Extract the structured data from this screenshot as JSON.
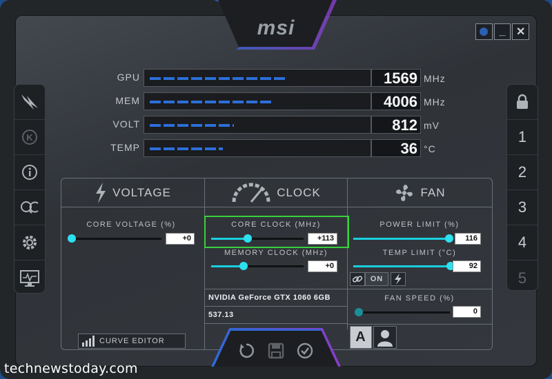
{
  "app": {
    "logo": "msi"
  },
  "window_controls": {
    "minimize": "_",
    "close": "✕"
  },
  "monitors": [
    {
      "label": "GPU",
      "value": "1569",
      "unit": "MHz",
      "level": 0.62
    },
    {
      "label": "MEM",
      "value": "4006",
      "unit": "MHz",
      "level": 0.55
    },
    {
      "label": "VOLT",
      "value": "812",
      "unit": "mV",
      "level": 0.38
    },
    {
      "label": "TEMP",
      "value": "36",
      "unit": "°C",
      "level": 0.33
    }
  ],
  "left_sidebar": {
    "items": [
      {
        "icon": "msi-dragon-icon"
      },
      {
        "icon": "kombustor-k-icon"
      },
      {
        "icon": "info-icon"
      },
      {
        "icon": "oc-scanner-icon"
      },
      {
        "icon": "settings-gear-icon"
      },
      {
        "icon": "monitor-icon"
      }
    ]
  },
  "right_sidebar": {
    "lock_icon": "lock-icon",
    "profiles": [
      "1",
      "2",
      "3",
      "4",
      "5"
    ]
  },
  "voltage": {
    "header": "VOLTAGE",
    "core_voltage_label": "CORE VOLTAGE  (%)",
    "core_voltage_value": "+0",
    "core_voltage_level": 0.0,
    "curve_editor_label": "CURVE EDITOR"
  },
  "clock": {
    "header": "CLOCK",
    "core_clock_label": "CORE CLOCK (MHz)",
    "core_clock_value": "+113",
    "core_clock_level": 0.4,
    "memory_clock_label": "MEMORY CLOCK (MHz)",
    "memory_clock_value": "+0",
    "memory_clock_level": 0.36,
    "gpu_name": "NVIDIA GeForce GTX 1060 6GB",
    "driver_version": "537.13"
  },
  "fan": {
    "header": "FAN",
    "power_limit_label": "POWER LIMIT  (%)",
    "power_limit_value": "116",
    "temp_limit_label": "TEMP LIMIT (°C)",
    "temp_limit_value": "92",
    "link_toggle": "ON",
    "fan_speed_label": "FAN SPEED  (%)",
    "fan_speed_value": "0"
  },
  "bottom_actions": {
    "reset_icon": "reset-icon",
    "save_icon": "save-icon",
    "apply_icon": "apply-check-icon"
  },
  "fan_mode": {
    "auto_label": "A",
    "user_icon": "user-icon"
  },
  "watermark": "technewstoday.com",
  "colors": {
    "accent": "#2de0ee",
    "highlight": "#39d13d",
    "bar_blue": "#2c6fd9"
  }
}
